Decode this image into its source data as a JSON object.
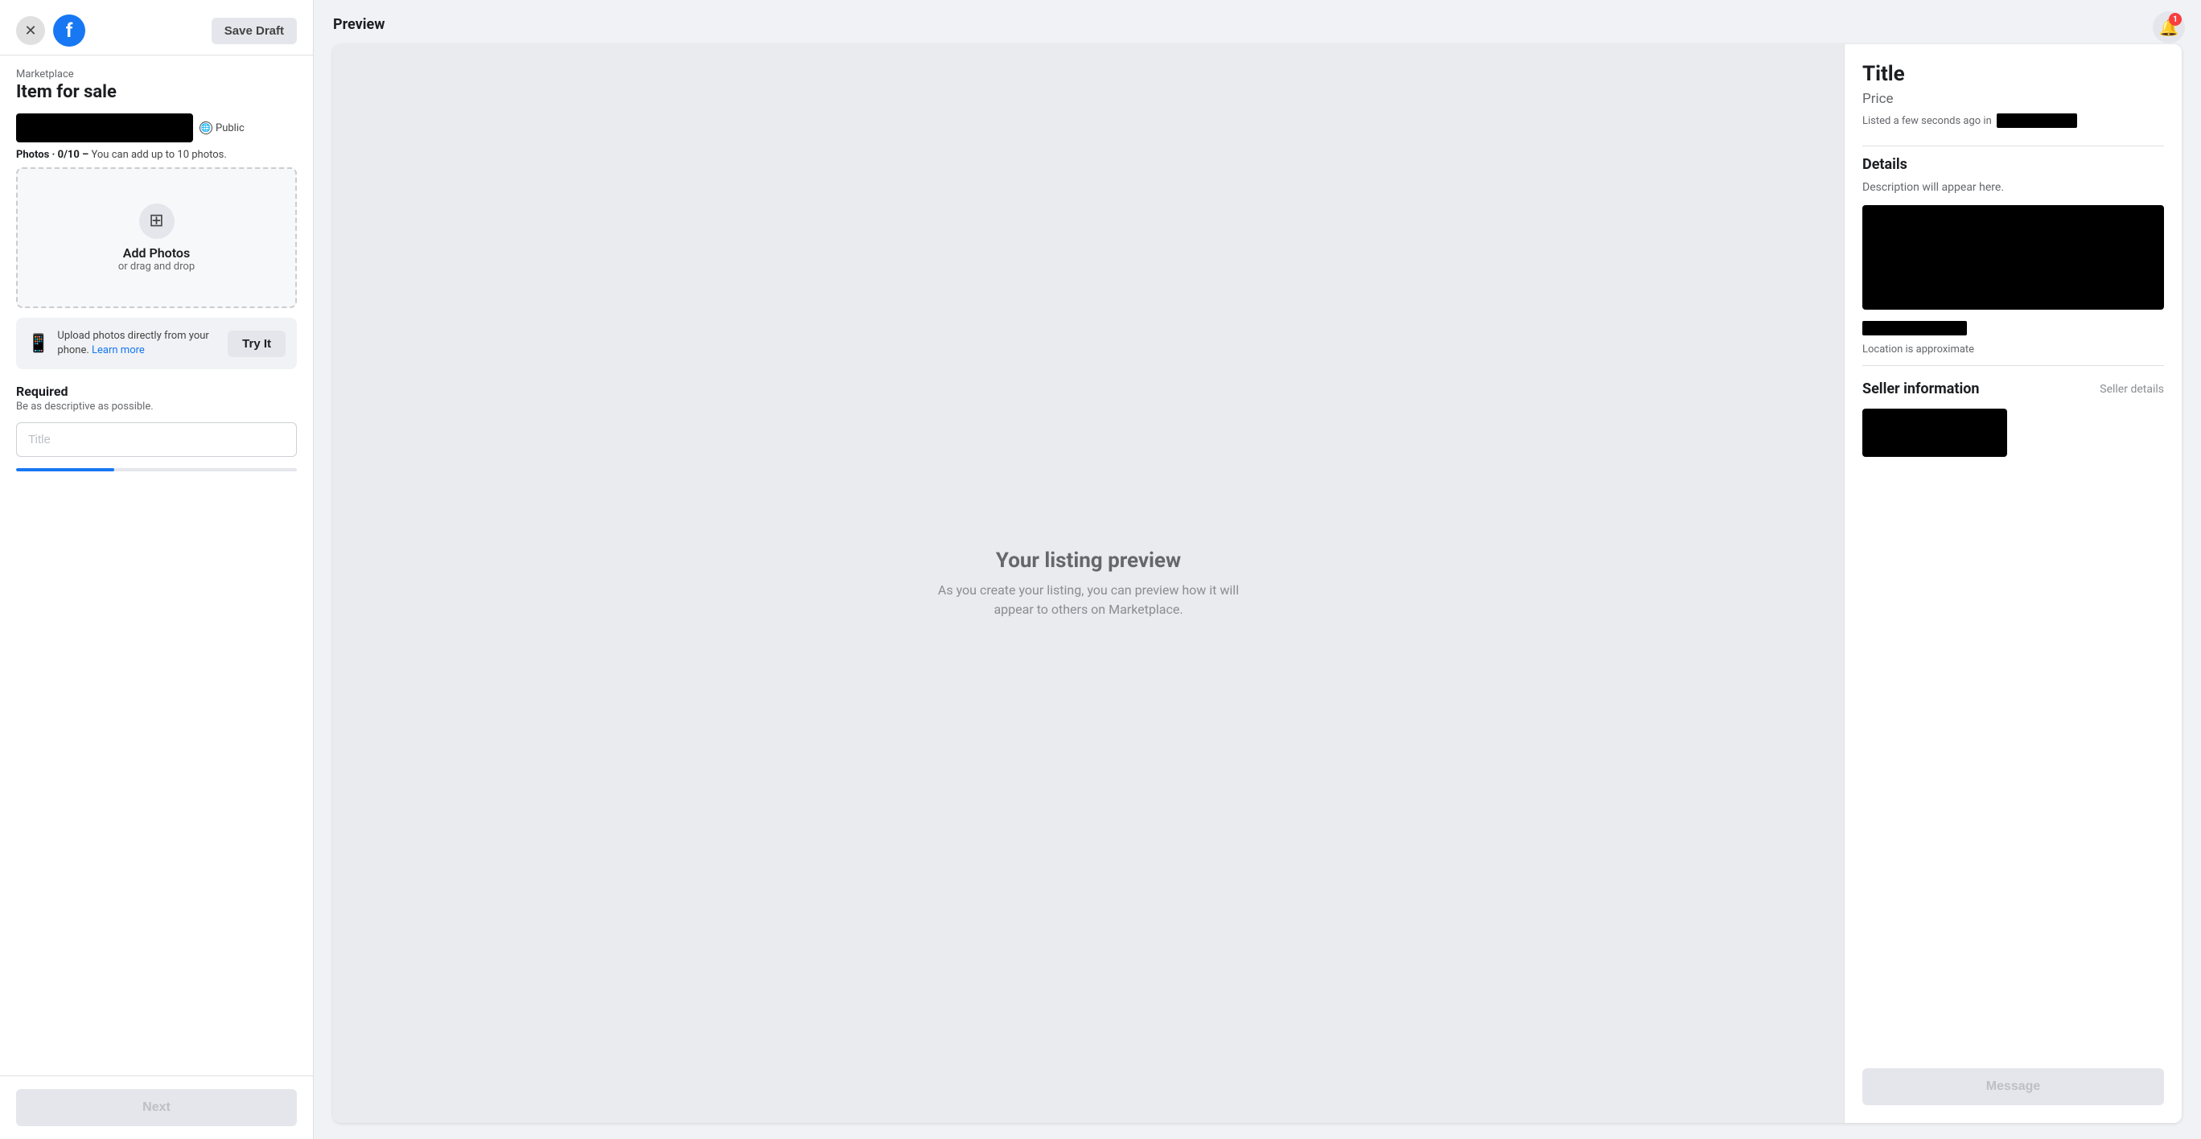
{
  "header": {
    "marketplace_label": "Marketplace",
    "page_title": "Item for sale",
    "save_draft_label": "Save Draft",
    "next_label": "Next"
  },
  "photos_section": {
    "public_label": "Public",
    "photos_count_label": "Photos · 0/10 –",
    "photos_count_sublabel": "You can add up to 10 photos.",
    "add_photos_label": "Add Photos",
    "drag_drop_label": "or drag and drop",
    "phone_upload_text": "Upload photos directly from your phone.",
    "learn_more_label": "Learn more",
    "try_it_label": "Try It"
  },
  "form_section": {
    "required_label": "Required",
    "required_sublabel": "Be as descriptive as possible.",
    "title_placeholder": "Title"
  },
  "preview": {
    "header": "Preview",
    "placeholder_title": "Your listing preview",
    "placeholder_subtitle": "As you create your listing, you can preview how it will appear to others on Marketplace.",
    "sidebar": {
      "title": "Title",
      "price": "Price",
      "listed_text": "Listed a few seconds ago in",
      "details_label": "Details",
      "description_text": "Description will appear here.",
      "location_approx": "Location is approximate",
      "seller_label": "Seller information",
      "seller_details_link": "Seller details",
      "message_btn_label": "Message"
    }
  },
  "notification": {
    "badge_count": "1"
  }
}
